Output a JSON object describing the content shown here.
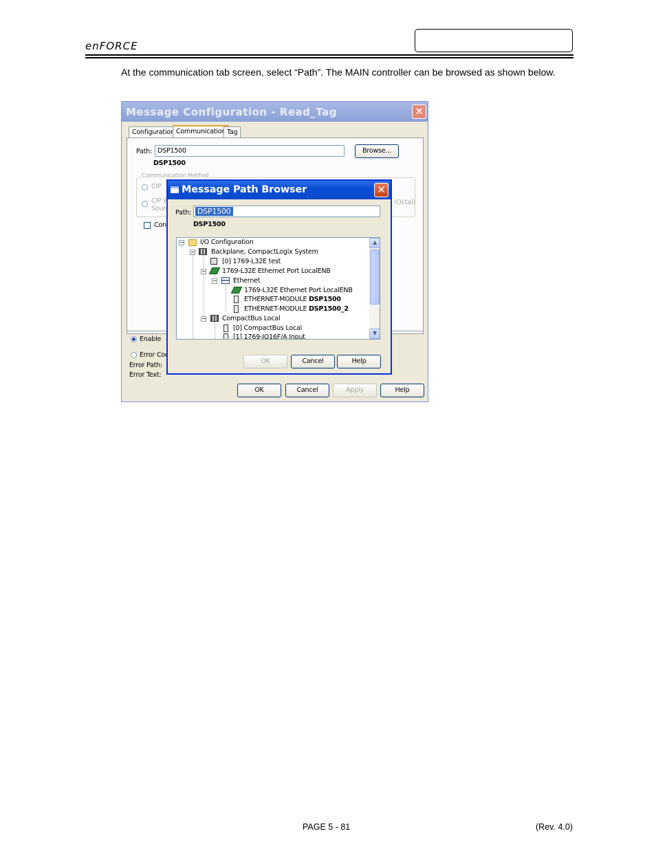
{
  "header": {
    "logo": "enFORCE"
  },
  "intro_text": "At the communication tab screen, select “Path”. The MAIN controller can be browsed as shown below.",
  "message_config": {
    "title": "Message Configuration - Read_Tag",
    "close_glyph": "✕",
    "tabs": [
      "Configuration",
      "Communication",
      "Tag"
    ],
    "active_tab": "Communication",
    "path_label": "Path:",
    "path_value": "DSP1500",
    "path_resolved": "DSP1500",
    "browse_label": "Browse...",
    "comm_method_label": "Communication Method",
    "cip_label_1": "CIP",
    "cip_label_2": "CIP W",
    "source_label": "Sourc",
    "octal_label": "(Octal)",
    "connected_label": "Conn",
    "enable_label": "Enable",
    "error_code_label": "Error Coc",
    "error_path_label": "Error Path:",
    "error_text_label": "Error Text:",
    "buttons": {
      "ok": "OK",
      "cancel": "Cancel",
      "apply": "Apply",
      "help": "Help"
    }
  },
  "path_browser": {
    "title": "Message Path Browser",
    "close_glyph": "✕",
    "path_label": "Path:",
    "path_value": "DSP1500",
    "path_resolved": "DSP1500",
    "tree": [
      {
        "label": "I/O Configuration",
        "expander": "−"
      },
      {
        "label": "Backplane, CompactLogix System",
        "expander": "−"
      },
      {
        "label": "[0] 1769-L32E test",
        "expander": ""
      },
      {
        "label": "1769-L32E Ethernet Port LocalENB",
        "expander": "−"
      },
      {
        "label": "Ethernet",
        "expander": "−"
      },
      {
        "label": "1769-L32E Ethernet Port LocalENB",
        "expander": ""
      },
      {
        "label": "ETHERNET-MODULE",
        "suffix": "DSP1500",
        "expander": ""
      },
      {
        "label": "ETHERNET-MODULE",
        "suffix": "DSP1500_2",
        "expander": ""
      },
      {
        "label": "CompactBus Local",
        "expander": "−"
      },
      {
        "label": "[0] CompactBus Local",
        "expander": ""
      },
      {
        "label": "[1] 1769-IQ16F/A Input",
        "expander": ""
      }
    ],
    "buttons": {
      "ok": "OK",
      "cancel": "Cancel",
      "help": "Help"
    }
  },
  "footer": {
    "page": "PAGE 5 - 81",
    "rev": "(Rev. 4.0)"
  }
}
